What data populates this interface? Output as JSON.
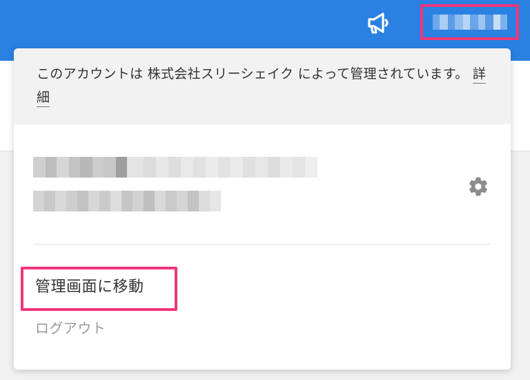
{
  "header": {
    "background_color": "#2a81e1",
    "announcement_icon": "megaphone-icon",
    "user_menu_button": {
      "label_obscured": true,
      "highlight_color": "#f0357a"
    }
  },
  "account_panel": {
    "notice": {
      "text": "このアカウントは 株式会社スリーシェイク によって管理されています。",
      "link_label": "詳細"
    },
    "user_info": {
      "name_obscured": true,
      "email_obscured": true
    },
    "settings_icon": "gear-icon",
    "menu": {
      "admin_label": "管理画面に移動",
      "logout_label": "ログアウト"
    },
    "highlight_color": "#f0357a"
  }
}
